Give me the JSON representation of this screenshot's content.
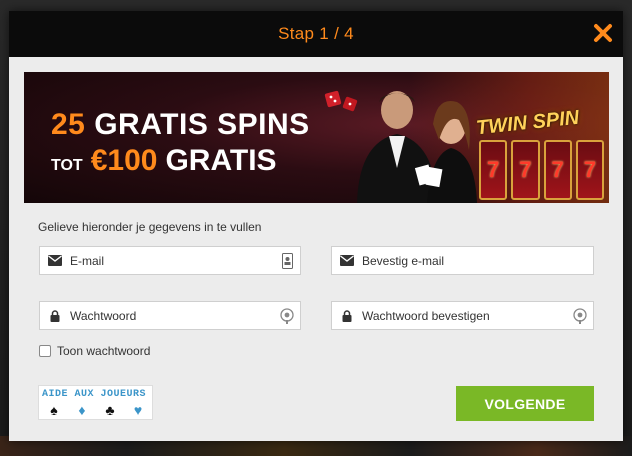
{
  "modal": {
    "step_title": "Stap 1 / 4",
    "close_icon": "close-icon"
  },
  "banner": {
    "line1_number": "25",
    "line1_text": "GRATIS SPINS",
    "line2_prefix": "TOT",
    "line2_amount": "€100",
    "line2_text": "GRATIS",
    "slot_logo": "TWIN SPIN",
    "reels": [
      "7",
      "7",
      "7",
      "7"
    ]
  },
  "form": {
    "intro": "Gelieve hieronder je gegevens in te vullen",
    "email_placeholder": "E-mail",
    "confirm_email_placeholder": "Bevestig e-mail",
    "password_placeholder": "Wachtwoord",
    "confirm_password_placeholder": "Wachtwoord bevestigen",
    "show_password_label": "Toon wachtwoord"
  },
  "footer": {
    "aide_text": "AIDE AUX JOUEURS",
    "next_label": "VOLGENDE"
  },
  "colors": {
    "accent": "#ff8a1c",
    "button": "#7ab826",
    "header_bg": "#0b0b0b"
  }
}
